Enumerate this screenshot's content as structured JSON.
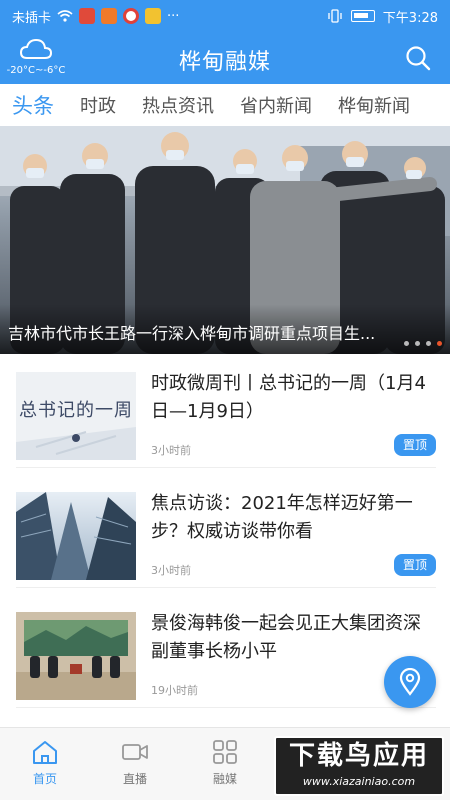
{
  "status_bar": {
    "carrier": "未插卡",
    "more": "···",
    "time": "下午3:28"
  },
  "header": {
    "weather": "-20°C~-6°C",
    "title": "桦甸融媒"
  },
  "tabs": [
    {
      "label": "头条",
      "active": true
    },
    {
      "label": "时政"
    },
    {
      "label": "热点资讯"
    },
    {
      "label": "省内新闻"
    },
    {
      "label": "桦甸新闻"
    }
  ],
  "banner": {
    "caption": "吉林市代市长王路一行深入桦甸市调研重点项目生...",
    "dot_count": 4,
    "active_dot": 3
  },
  "news": [
    {
      "thumb_text": "总书记的一周",
      "headline": "时政微周刊丨总书记的一周（1月4日—1月9日）",
      "time": "3小时前",
      "pin": "置顶"
    },
    {
      "headline": "焦点访谈：2021年怎样迈好第一步？权威访谈带你看",
      "time": "3小时前",
      "pin": "置顶"
    },
    {
      "headline": "景俊海韩俊一起会见正大集团资深副董事长杨小平",
      "time": "19小时前"
    }
  ],
  "bottom_nav": [
    {
      "label": "首页",
      "icon": "home-icon",
      "active": true
    },
    {
      "label": "直播",
      "icon": "video-camera-icon"
    },
    {
      "label": "融媒",
      "icon": "grid-icon"
    }
  ],
  "watermark": {
    "main": "下载鸟应用",
    "sub": "www.xiazainiao.com"
  },
  "colors": {
    "accent": "#3a97f0",
    "pin": "#3a97f0",
    "active_dot": "#e8542b"
  }
}
